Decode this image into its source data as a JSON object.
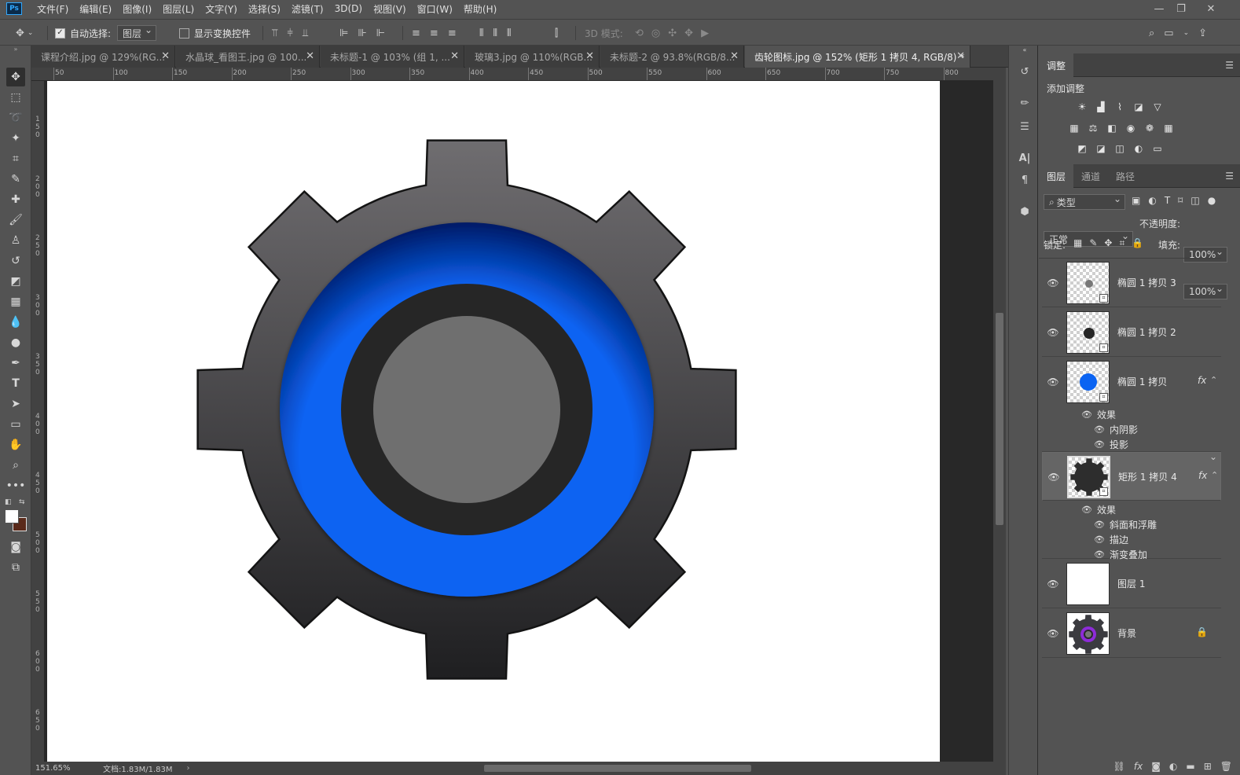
{
  "app": {
    "logo": "Ps"
  },
  "menu": [
    "文件(F)",
    "编辑(E)",
    "图像(I)",
    "图层(L)",
    "文字(Y)",
    "选择(S)",
    "滤镜(T)",
    "3D(D)",
    "视图(V)",
    "窗口(W)",
    "帮助(H)"
  ],
  "window_controls": [
    "—",
    "❐",
    "✕"
  ],
  "options": {
    "auto_select_label": "自动选择:",
    "auto_select_checked": true,
    "auto_select_target": "图层",
    "show_transform_label": "显示变换控件",
    "mode_3d_label": "3D 模式:"
  },
  "tabs": [
    {
      "label": "课程介绍.jpg @ 129%(RG...",
      "active": false
    },
    {
      "label": "水晶球_看图王.jpg @ 100...",
      "active": false
    },
    {
      "label": "未标题-1 @ 103% (组 1, ...",
      "active": false
    },
    {
      "label": "玻璃3.jpg @ 110%(RGB...",
      "active": false
    },
    {
      "label": "未标题-2 @ 93.8%(RGB/8...",
      "active": false
    },
    {
      "label": "齿轮图标.jpg @ 152% (矩形 1 拷贝 4, RGB/8) *",
      "active": true
    }
  ],
  "ruler": {
    "h_ticks": [
      "50",
      "100",
      "150",
      "200",
      "250",
      "300",
      "350",
      "400",
      "450",
      "500",
      "550",
      "600",
      "650",
      "700",
      "750",
      "800"
    ],
    "v_ticks": [
      "150",
      "200",
      "250",
      "300",
      "350",
      "400",
      "450",
      "500",
      "550",
      "600",
      "650"
    ]
  },
  "status": {
    "zoom": "151.65%",
    "doc": "文档:1.83M/1.83M"
  },
  "colors": {
    "gear_top": "#6f6d70",
    "gear_bottom": "#1f1f21",
    "ring_blue": "#0a63f2",
    "ring_dark": "#262626",
    "center_gray": "#6f6f6f",
    "ps_accent": "#31a8ff"
  },
  "adjustments": {
    "tab": "调整",
    "add_label": "添加调整"
  },
  "layers_panel": {
    "tabs": [
      "图层",
      "通道",
      "路径"
    ],
    "filter_kind": "类型",
    "blend_mode": "正常",
    "opacity_label": "不透明度:",
    "opacity_value": "100%",
    "lock_label": "锁定:",
    "fill_label": "填充:",
    "fill_value": "100%",
    "layers": [
      {
        "name": "椭圆 1 拷贝 3",
        "thumb": "small-gray-dot",
        "fx": false
      },
      {
        "name": "椭圆 1 拷贝 2",
        "thumb": "dark-dot",
        "fx": false
      },
      {
        "name": "椭圆 1 拷贝",
        "thumb": "blue-dot",
        "fx": true,
        "effects_label": "效果",
        "effects": [
          "内阴影",
          "投影"
        ]
      },
      {
        "name": "矩形 1 拷贝 4",
        "thumb": "gear",
        "fx": true,
        "selected": true,
        "effects_label": "效果",
        "effects": [
          "斜面和浮雕",
          "描边",
          "渐变叠加"
        ]
      },
      {
        "name": "图层 1",
        "thumb": "white",
        "fx": false
      },
      {
        "name": "背景",
        "thumb": "purple-gear",
        "fx": false,
        "locked": true
      }
    ]
  }
}
